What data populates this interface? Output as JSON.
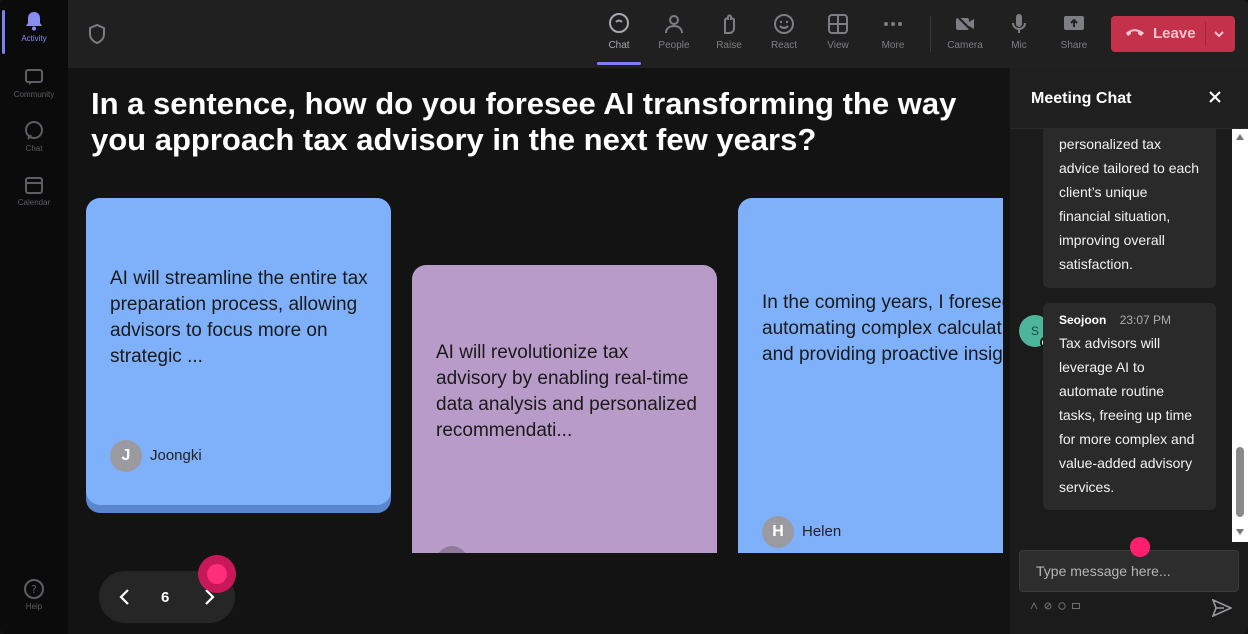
{
  "rail": [
    {
      "label": "Activity",
      "icon": "bell-icon",
      "active": true
    },
    {
      "label": "Community",
      "icon": "community-icon"
    },
    {
      "label": "Chat",
      "icon": "chat-icon"
    },
    {
      "label": "Calendar",
      "icon": "calendar-icon"
    },
    {
      "label": "Help",
      "icon": "help-icon"
    }
  ],
  "toolbar": {
    "chat": "Chat",
    "people": "People",
    "raise": "Raise",
    "react": "React",
    "view": "View",
    "more": "More",
    "camera": "Camera",
    "mic": "Mic",
    "share": "Share",
    "leave": "Leave"
  },
  "question": "In a sentence, how do you foresee AI transforming the way you approach tax advisory in the next few years?",
  "cards": [
    {
      "text": "AI will streamline the entire tax preparation process, allowing advisors to focus more on strategic ...",
      "author": "Joongki",
      "initial": "J"
    },
    {
      "text": "AI will revolutionize tax advisory by enabling real-time data analysis and personalized recommendati...",
      "author": "",
      "initial": ""
    },
    {
      "text": "In the coming years, I foresee AI automating complex calculations and providing proactive insights ...",
      "author": "Helen",
      "initial": "H"
    }
  ],
  "pager": {
    "page": "6"
  },
  "chat": {
    "title": "Meeting Chat",
    "messages": [
      {
        "text": "personalized tax advice tailored to each client’s unique financial situation, improving overall satisfaction."
      },
      {
        "sender": "Seojoon",
        "initial": "S",
        "time": "23:07 PM",
        "text": "Tax advisors will leverage AI to automate routine tasks, freeing up time for more complex and value-added advisory services."
      }
    ],
    "placeholder": "Type message here..."
  },
  "colors": {
    "accent": "#7b80f3",
    "leave": "#c4314b",
    "card_blue": "#7fb0fa",
    "card_purple": "#b89bc8",
    "pointer": "#ff2e7a"
  }
}
